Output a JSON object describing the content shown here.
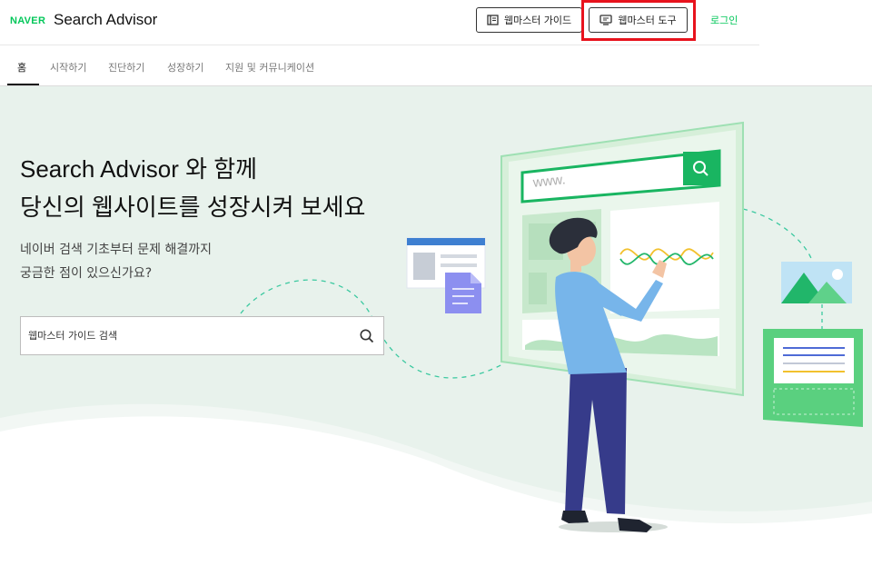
{
  "brand": {
    "naver": "NAVER",
    "title": "Search Advisor"
  },
  "header": {
    "guide_button": "웹마스터 가이드",
    "tools_button": "웹마스터 도구",
    "login": "로그인"
  },
  "tabs": [
    {
      "label": "홈",
      "active": true
    },
    {
      "label": "시작하기"
    },
    {
      "label": "진단하기"
    },
    {
      "label": "성장하기"
    },
    {
      "label": "지원 및 커뮤니케이션"
    }
  ],
  "hero": {
    "headline_line1": "Search Advisor 와 함께",
    "headline_line2": "당신의 웹사이트를 성장시켜 보세요",
    "sub_line1": "네이버 검색 기초부터 문제 해결까지",
    "sub_line2": "궁금한 점이 있으신가요?",
    "search_placeholder": "웹마스터 가이드 검색",
    "illustration_url": "www."
  },
  "colors": {
    "brand_green": "#03c75a",
    "highlight_red": "#e8131d",
    "hero_bg": "#e8f2ec"
  },
  "icons": [
    "book-icon",
    "monitor-icon",
    "search-icon",
    "magnifier-icon"
  ]
}
